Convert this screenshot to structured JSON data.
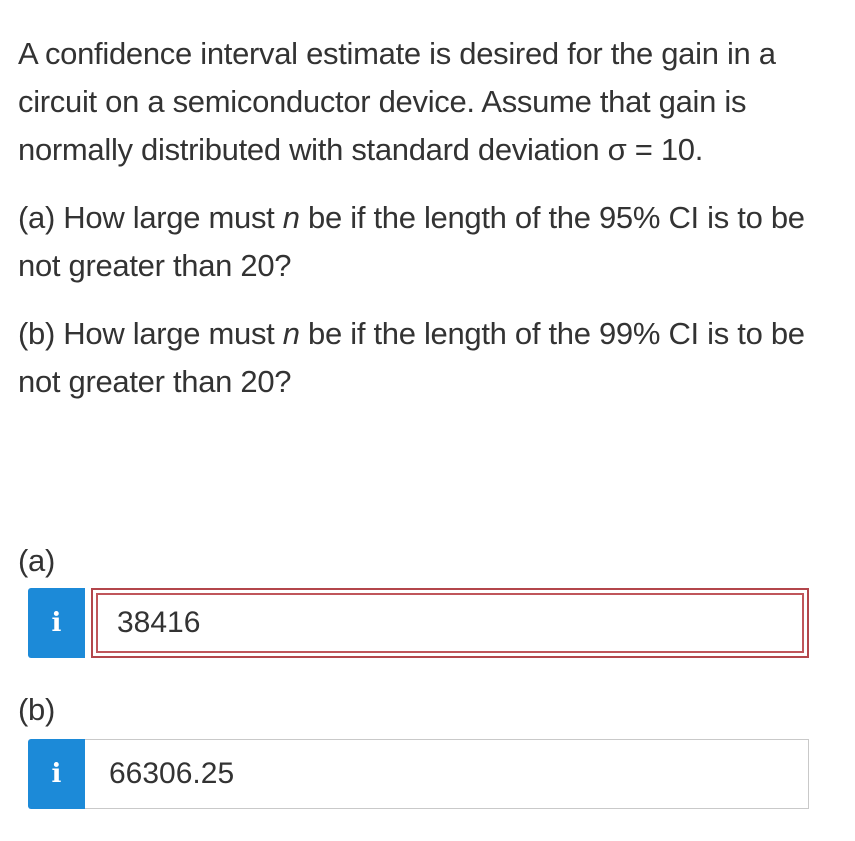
{
  "question": {
    "intro": "A confidence interval estimate is desired for the gain in a circuit on a semiconductor device. Assume that gain is normally distributed with standard deviation σ = 10.",
    "part_a_prefix": "(a) How large must ",
    "part_a_var": "n",
    "part_a_suffix": " be if the length of the 95% CI is to be not greater than 20?",
    "part_b_prefix": "(b) How large must ",
    "part_b_var": "n",
    "part_b_suffix": " be if the length of the 99% CI is to be not greater than 20?"
  },
  "answers": {
    "a": {
      "label": "(a)",
      "info_icon": "i",
      "value": "38416",
      "state": "incorrect"
    },
    "b": {
      "label": "(b)",
      "info_icon": "i",
      "value": "66306.25",
      "state": "normal"
    }
  },
  "colors": {
    "info_button": "#1c8ad8",
    "error_border": "#b3464b",
    "text": "#333333"
  }
}
